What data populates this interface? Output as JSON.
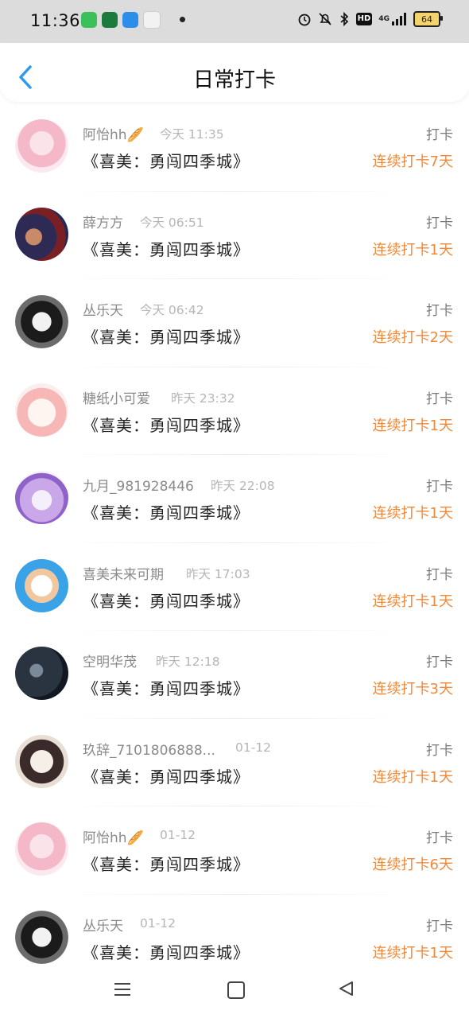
{
  "status_bar": {
    "time": "11:36",
    "battery": "64",
    "network": "4G",
    "hd": "HD",
    "icons": [
      "alarm-icon",
      "mute-icon",
      "bluetooth-icon",
      "hd-icon",
      "signal-icon",
      "battery-icon"
    ]
  },
  "header": {
    "title": "日常打卡",
    "back_icon": "chevron-left-icon"
  },
  "colors": {
    "accent": "#2c9aee",
    "streak": "#f0893a",
    "name": "#8a8a8a",
    "time": "#b6b6b6"
  },
  "items": [
    {
      "name": "阿怡hh🥖",
      "time": "今天 11:35",
      "book": "《喜美：勇闯四季城》",
      "check": "打卡",
      "streak": "连续打卡7天"
    },
    {
      "name": "薛方方",
      "time": "今天 06:51",
      "book": "《喜美：勇闯四季城》",
      "check": "打卡",
      "streak": "连续打卡1天"
    },
    {
      "name": "丛乐天",
      "time": "今天 06:42",
      "book": "《喜美：勇闯四季城》",
      "check": "打卡",
      "streak": "连续打卡2天"
    },
    {
      "name": "糖纸小可爱",
      "time": "昨天 23:32",
      "book": "《喜美：勇闯四季城》",
      "check": "打卡",
      "streak": "连续打卡1天"
    },
    {
      "name": "九月_981928446",
      "time": "昨天 22:08",
      "book": "《喜美：勇闯四季城》",
      "check": "打卡",
      "streak": "连续打卡1天"
    },
    {
      "name": "喜美未来可期",
      "time": "昨天 17:03",
      "book": "《喜美：勇闯四季城》",
      "check": "打卡",
      "streak": "连续打卡1天"
    },
    {
      "name": "空明华茂",
      "time": "昨天 12:18",
      "book": "《喜美：勇闯四季城》",
      "check": "打卡",
      "streak": "连续打卡3天"
    },
    {
      "name": "玖辞_7101806888...",
      "time": "01-12",
      "book": "《喜美：勇闯四季城》",
      "check": "打卡",
      "streak": "连续打卡1天"
    },
    {
      "name": "阿怡hh🥖",
      "time": "01-12",
      "book": "《喜美：勇闯四季城》",
      "check": "打卡",
      "streak": "连续打卡6天"
    },
    {
      "name": "丛乐天",
      "time": "01-12",
      "book": "《喜美：勇闯四季城》",
      "check": "打卡",
      "streak": "连续打卡1天"
    }
  ]
}
